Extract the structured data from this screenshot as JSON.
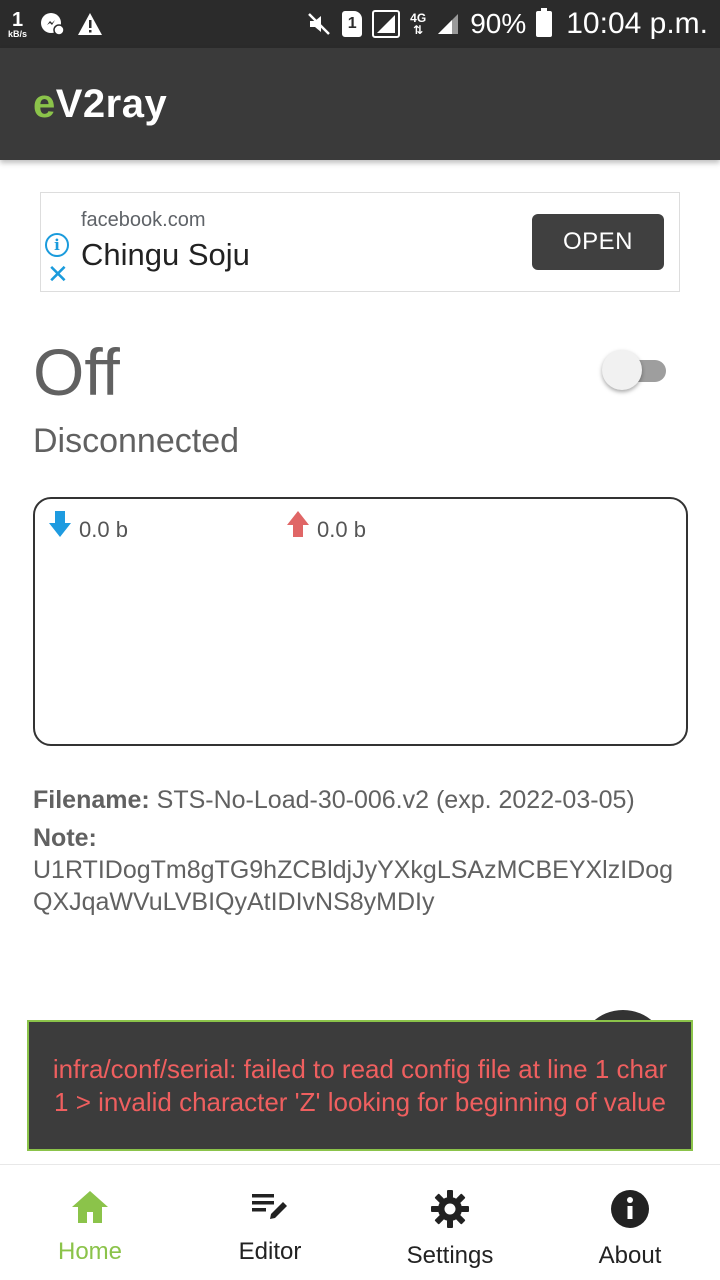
{
  "status_bar": {
    "net_speed_value": "1",
    "net_speed_unit": "kB/s",
    "sim_slot": "1",
    "network_type": "4G",
    "battery_percent": "90%",
    "time": "10:04 p.m."
  },
  "app_bar": {
    "title_prefix": "e",
    "title_rest": "V2ray",
    "accent_color": "#8bc34a"
  },
  "ad": {
    "domain": "facebook.com",
    "title": "Chingu Soju",
    "button_label": "OPEN"
  },
  "connection": {
    "state": "Off",
    "status": "Disconnected",
    "toggle_on": false
  },
  "traffic": {
    "download": "0.0 b",
    "upload": "0.0 b"
  },
  "file": {
    "filename_label": "Filename:",
    "filename_value": "STS-No-Load-30-006.v2 (exp. 2022-03-05)",
    "note_label": "Note:",
    "note_value": "U1RTIDogTm8gTG9hZCBldjJyYXkgLSAzMCBEYXlzIDogQXJqaWVuLVBIQyAtIDIvNS8yMDIy"
  },
  "toast": {
    "message": "infra/conf/serial: failed to read config file at line 1 char 1 > invalid character 'Z' looking for beginning of value"
  },
  "bottom_nav": {
    "items": [
      {
        "label": "Home",
        "icon": "home-icon",
        "active": true
      },
      {
        "label": "Editor",
        "icon": "edit-icon",
        "active": false
      },
      {
        "label": "Settings",
        "icon": "gear-icon",
        "active": false
      },
      {
        "label": "About",
        "icon": "info-icon",
        "active": false
      }
    ]
  }
}
